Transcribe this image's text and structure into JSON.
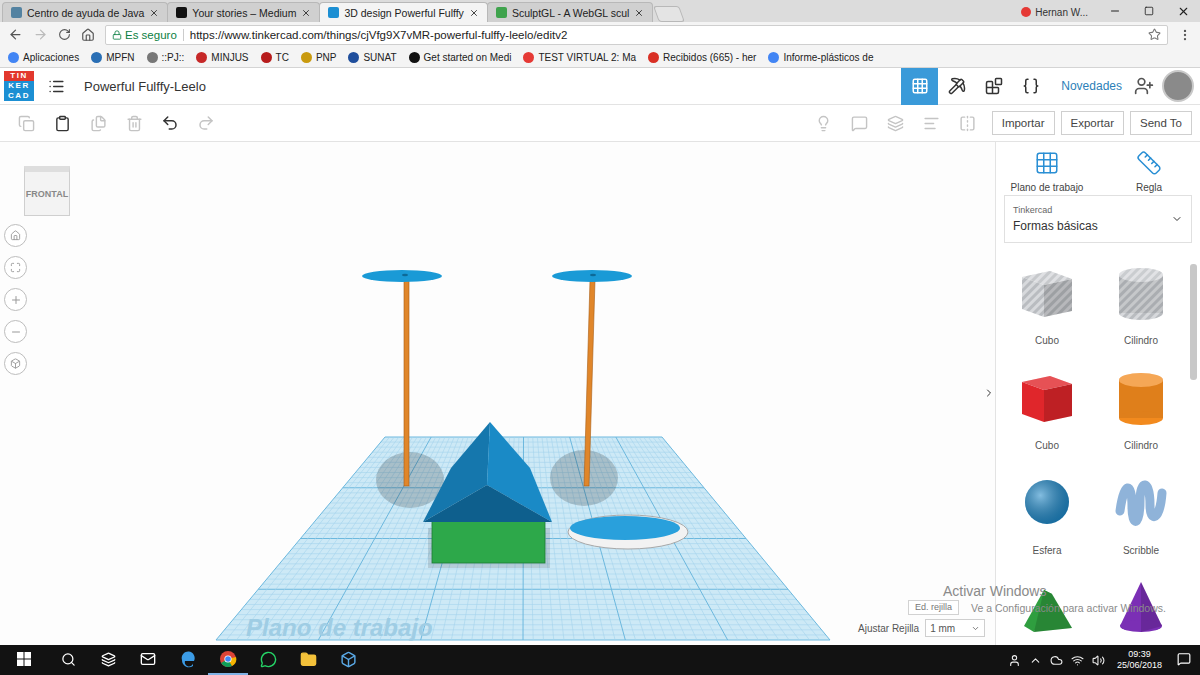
{
  "browser": {
    "tabs": [
      {
        "title": "Centro de ayuda de Java",
        "selected": false,
        "color": "#5382a1"
      },
      {
        "title": "Your stories – Medium",
        "selected": false,
        "color": "#111111"
      },
      {
        "title": "3D design Powerful Fulffy",
        "selected": true,
        "color": "#1c8fd3"
      },
      {
        "title": "SculptGL - A WebGL scul",
        "selected": false,
        "color": "#3fa34d"
      }
    ],
    "profile": "Hernan W...",
    "secure_label": "Es seguro",
    "url": "https://www.tinkercad.com/things/cjVfg9X7vMR-powerful-fulffy-leelo/editv2",
    "bookmarks": [
      {
        "label": "Aplicaciones",
        "color": "#4285f4"
      },
      {
        "label": "MPFN",
        "color": "#2a6fb5"
      },
      {
        "label": "::PJ::",
        "color": "#777777"
      },
      {
        "label": "MINJUS",
        "color": "#c62828"
      },
      {
        "label": "TC",
        "color": "#b71c1c"
      },
      {
        "label": "PNP",
        "color": "#c99a0e"
      },
      {
        "label": "SUNAT",
        "color": "#1f4e9c"
      },
      {
        "label": "Get started on Medi",
        "color": "#111111"
      },
      {
        "label": "TEST VIRTUAL 2: Ma",
        "color": "#e53935"
      },
      {
        "label": "Recibidos (665) - her",
        "color": "#d93025"
      },
      {
        "label": "Informe-plásticos de",
        "color": "#4285f4"
      }
    ]
  },
  "app": {
    "logo": [
      "TIN",
      "KER",
      "CAD"
    ],
    "design_title": "Powerful Fulffy-Leelo",
    "modes": [
      {
        "selected": true
      },
      {
        "selected": false
      },
      {
        "selected": false
      },
      {
        "selected": false
      }
    ],
    "news": "Novedades"
  },
  "toolbar": {
    "buttons": [
      "Importar",
      "Exportar",
      "Send To"
    ]
  },
  "canvas": {
    "viewcube": "FRONTAL",
    "workplane_label": "Plano de trabajo",
    "edit_grid": "Ed. rejilla",
    "snap_label": "Ajustar Rejilla",
    "snap_value": "1 mm"
  },
  "watermark": {
    "title": "Activar Windows",
    "subtitle": "Ve a Configuración para activar Windows."
  },
  "panel": {
    "tools": [
      "Plano de trabajo",
      "Regla"
    ],
    "library_source": "Tinkercad",
    "library": "Formas básicas",
    "shapes": [
      {
        "label": "Cubo",
        "kind": "box",
        "hole": true,
        "color": "#b9bcc0"
      },
      {
        "label": "Cilindro",
        "kind": "cylinder",
        "hole": true,
        "color": "#b9bcc0"
      },
      {
        "label": "Cubo",
        "kind": "box",
        "hole": false,
        "color": "#e0262b"
      },
      {
        "label": "Cilindro",
        "kind": "cylinder",
        "hole": false,
        "color": "#f28a1e"
      },
      {
        "label": "Esfera",
        "kind": "sphere",
        "hole": false,
        "color": "#1e88c8"
      },
      {
        "label": "Scribble",
        "kind": "scribble",
        "hole": false,
        "color": "#8fb3d9"
      },
      {
        "label": "",
        "kind": "roof",
        "hole": false,
        "color": "#2f9e3f"
      },
      {
        "label": "",
        "kind": "cone",
        "hole": false,
        "color": "#7b2fb5"
      }
    ]
  },
  "taskbar": {
    "time": "09:39",
    "date": "25/06/2018"
  }
}
